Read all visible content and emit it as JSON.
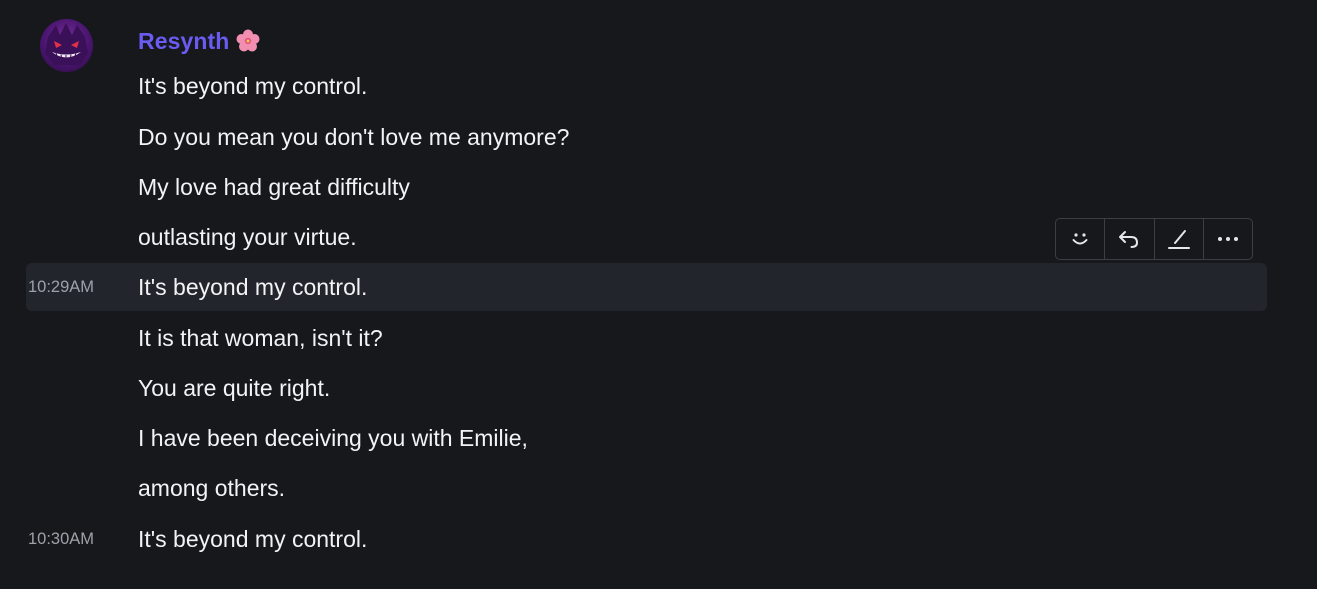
{
  "author": {
    "name": "Resynth",
    "name_color": "#6a5cf2",
    "avatar_icon": "gengar-avatar",
    "badge_icon": "hibiscus-flower-icon"
  },
  "messages": [
    {
      "text": "It's beyond my control.",
      "timestamp": ""
    },
    {
      "text": "Do you mean you don't love me anymore?",
      "timestamp": ""
    },
    {
      "text": "My love had great difficulty",
      "timestamp": ""
    },
    {
      "text": "outlasting your virtue.",
      "timestamp": ""
    },
    {
      "text": "It's beyond my control.",
      "timestamp": "10:29AM"
    },
    {
      "text": "It is that woman, isn't it?",
      "timestamp": ""
    },
    {
      "text": "You are quite right.",
      "timestamp": ""
    },
    {
      "text": "I have been deceiving you with Emilie,",
      "timestamp": ""
    },
    {
      "text": "among others.",
      "timestamp": ""
    },
    {
      "text": "It's beyond my control.",
      "timestamp": "10:30AM"
    }
  ],
  "hovered_message_index": 4,
  "toolbar": {
    "buttons": [
      {
        "icon": "smile-icon",
        "action": "add-reaction"
      },
      {
        "icon": "reply-icon",
        "action": "reply"
      },
      {
        "icon": "edit-icon",
        "action": "edit"
      },
      {
        "icon": "more-icon",
        "action": "more"
      }
    ]
  },
  "colors": {
    "background": "#17181c",
    "hover_background": "#23252c",
    "text": "#f2f3f5",
    "timestamp": "#9ea1ab",
    "toolbar_border": "#3b3e47"
  }
}
